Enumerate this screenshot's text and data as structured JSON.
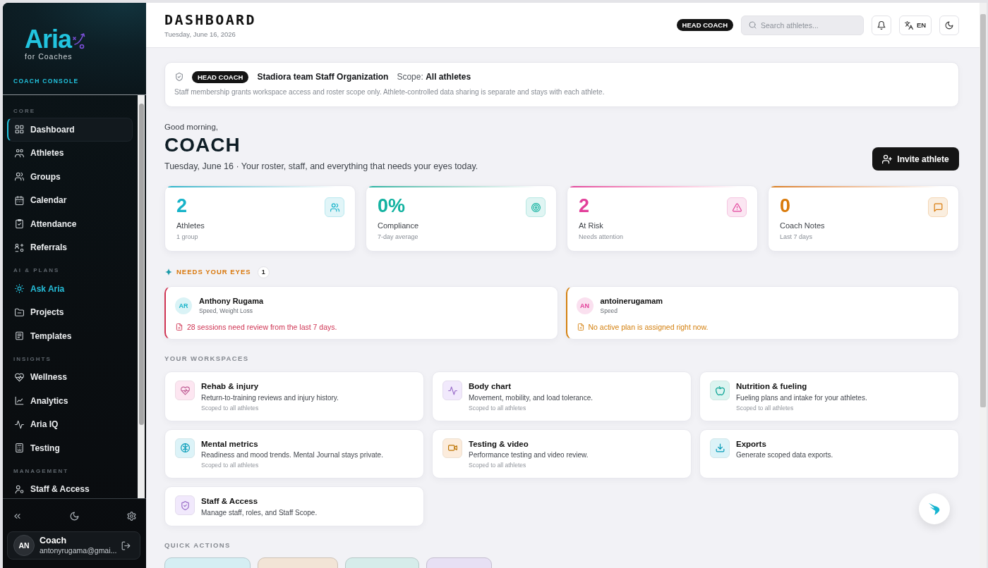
{
  "sidebar": {
    "logo": {
      "wordmark": "Aria",
      "tagline": "for Coaches"
    },
    "console_label": "COACH CONSOLE",
    "sections": [
      {
        "title": "CORE",
        "items": [
          {
            "label": "Dashboard",
            "kind": "page",
            "selected": true
          },
          {
            "label": "Athletes",
            "kind": "page",
            "selected": false
          },
          {
            "label": "Groups",
            "kind": "page",
            "selected": false
          },
          {
            "label": "Calendar",
            "kind": "page",
            "selected": false
          },
          {
            "label": "Attendance",
            "kind": "page",
            "selected": false
          },
          {
            "label": "Referrals",
            "kind": "page",
            "selected": false
          }
        ]
      },
      {
        "title": "AI & PLANS",
        "items": [
          {
            "label": "Ask Aria",
            "kind": "assistant",
            "selected": false
          },
          {
            "label": "Projects",
            "kind": "page",
            "selected": false
          },
          {
            "label": "Templates",
            "kind": "page",
            "selected": false
          }
        ]
      },
      {
        "title": "INSIGHTS",
        "items": [
          {
            "label": "Wellness",
            "kind": "page",
            "selected": false
          },
          {
            "label": "Analytics",
            "kind": "page",
            "selected": false
          },
          {
            "label": "Aria IQ",
            "kind": "page",
            "selected": false
          },
          {
            "label": "Testing",
            "kind": "page",
            "selected": false
          }
        ]
      },
      {
        "title": "MANAGEMENT",
        "items": [
          {
            "label": "Staff & Access",
            "kind": "page",
            "selected": false
          }
        ]
      }
    ],
    "user": {
      "initials": "AN",
      "name": "Coach",
      "email": "antonyrugama@gmai..."
    }
  },
  "header": {
    "title": "DASHBOARD",
    "date": "Tuesday, June 16, 2026",
    "role_badge": "HEAD COACH",
    "search": {
      "placeholder": "Search athletes..."
    },
    "language": "EN"
  },
  "staff_banner": {
    "role_badge": "HEAD COACH",
    "organization": "Stadiora team Staff Organization",
    "scope": "Scope: **All athletes**",
    "note": "Staff membership grants workspace access and roster scope only. Athlete-controlled data sharing is separate and stays with each athlete."
  },
  "greeting": {
    "salutation": "Good morning,",
    "name": "COACH",
    "subtitle": "Tuesday, June 16 · Your roster, staff, and everything that needs your eyes today.",
    "action": "Invite athlete"
  },
  "stats": [
    {
      "value": "2",
      "label": "Athletes",
      "note": "1 group",
      "color": "#17b3c9"
    },
    {
      "value": "0%",
      "label": "Compliance",
      "note": "7-day average",
      "color": "#12b2a0"
    },
    {
      "value": "2",
      "label": "At Risk",
      "note": "Needs attention",
      "color": "#e2409a"
    },
    {
      "value": "0",
      "label": "Coach Notes",
      "note": "Last 7 days",
      "color": "#d97a0a"
    }
  ],
  "needs_your_eyes": {
    "title": "NEEDS YOUR EYES",
    "count": "1",
    "alerts": [
      {
        "avatar": {
          "initials": "AR",
          "color": "#17b3c9"
        },
        "name": "Anthony Rugama",
        "tags": "Speed, Weight Loss",
        "message": "28 sessions need review from the last 7 days.",
        "color": "#cf3453"
      },
      {
        "avatar": {
          "initials": "AN",
          "color": "#e2409a"
        },
        "name": "antoinerugamam",
        "tags": "Speed",
        "message": "No active plan is assigned right now.",
        "color": "#d4800f"
      }
    ]
  },
  "workspaces": {
    "title": "YOUR WORKSPACES",
    "items": [
      {
        "title": "Rehab & injury",
        "description": "Return-to-training reviews and injury history.",
        "scope": "Scoped to all athletes",
        "color": "#fde6f1"
      },
      {
        "title": "Body chart",
        "description": "Movement, mobility, and load tolerance.",
        "scope": "Scoped to all athletes",
        "color": "#f1e9fc"
      },
      {
        "title": "Nutrition & fueling",
        "description": "Fueling plans and intake for your athletes.",
        "scope": "Scoped to all athletes",
        "color": "#dcf4f0"
      },
      {
        "title": "Mental metrics",
        "description": "Readiness and mood trends. Mental Journal stays private.",
        "scope": "Scoped to all athletes",
        "color": "#dcf3f8"
      },
      {
        "title": "Testing & video",
        "description": "Performance testing and video review.",
        "scope": "Scoped to all athletes",
        "color": "#fcecdc"
      },
      {
        "title": "Exports",
        "description": "Generate scoped data exports.",
        "color": "#dcf3f8"
      },
      {
        "title": "Staff & Access",
        "description": "Manage staff, roles, and Staff Scope.",
        "color": "#f1e9fc"
      }
    ]
  },
  "quick_actions": {
    "title": "QUICK ACTIONS",
    "tiles": [
      {
        "color": "#d5eef3"
      },
      {
        "color": "#f2e4d6"
      },
      {
        "color": "#d6ecea"
      },
      {
        "color": "#e7e0f4"
      }
    ]
  }
}
